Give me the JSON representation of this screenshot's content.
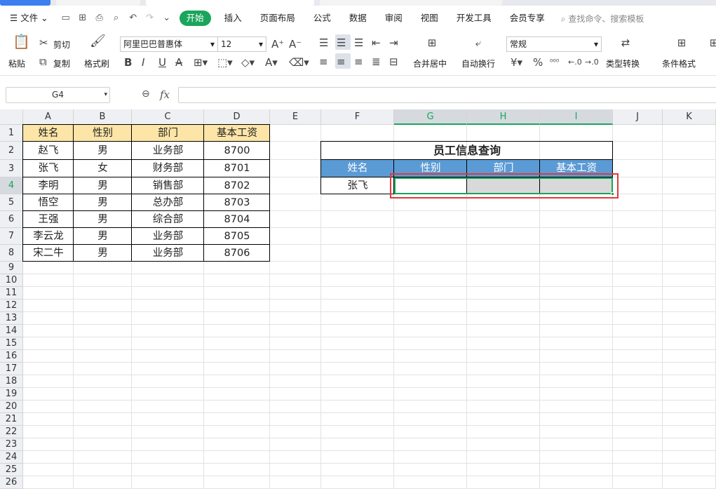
{
  "menu": {
    "hamburger_label": "文件",
    "active_tab": "开始",
    "tabs": [
      "插入",
      "页面布局",
      "公式",
      "数据",
      "审阅",
      "视图",
      "开发工具",
      "会员专享"
    ],
    "search_placeholder": "查找命令、搜索模板"
  },
  "ribbon": {
    "paste": "粘贴",
    "cut": "剪切",
    "copy": "复制",
    "format_painter": "格式刷",
    "font_name": "阿里巴巴普惠体",
    "font_size": "12",
    "merge_center": "合并居中",
    "wrap_text": "自动换行",
    "number_format": "常规",
    "type_convert": "类型转换",
    "conditional_format": "条件格式"
  },
  "formula_bar": {
    "name_box": "G4",
    "fx": "fx",
    "content": ""
  },
  "columns": [
    "A",
    "B",
    "C",
    "D",
    "E",
    "F",
    "G",
    "H",
    "I",
    "J",
    "K"
  ],
  "rows": [
    "1",
    "2",
    "3",
    "4",
    "5",
    "6",
    "7",
    "8",
    "9",
    "10",
    "11",
    "12",
    "13",
    "14",
    "15",
    "16",
    "17",
    "18",
    "19",
    "20",
    "21",
    "22",
    "23",
    "24",
    "25",
    "26"
  ],
  "employee_table": {
    "headers": [
      "姓名",
      "性别",
      "部门",
      "基本工资"
    ],
    "rows": [
      [
        "赵飞",
        "男",
        "业务部",
        "8700"
      ],
      [
        "张飞",
        "女",
        "财务部",
        "8701"
      ],
      [
        "李明",
        "男",
        "销售部",
        "8702"
      ],
      [
        "悟空",
        "男",
        "总办部",
        "8703"
      ],
      [
        "王强",
        "男",
        "综合部",
        "8704"
      ],
      [
        "李云龙",
        "男",
        "业务部",
        "8705"
      ],
      [
        "宋二牛",
        "男",
        "业务部",
        "8706"
      ]
    ]
  },
  "lookup_table": {
    "title": "员工信息查询",
    "headers": [
      "姓名",
      "性别",
      "部门",
      "基本工资"
    ],
    "query_name": "张飞",
    "results": [
      "",
      "",
      ""
    ]
  },
  "colors": {
    "accent": "#1aa55b",
    "header_fill": "#fce5a6",
    "lookup_header_fill": "#5b9bd5",
    "highlight_box": "#e03b3b",
    "selected_fill": "#d9d9d9"
  }
}
